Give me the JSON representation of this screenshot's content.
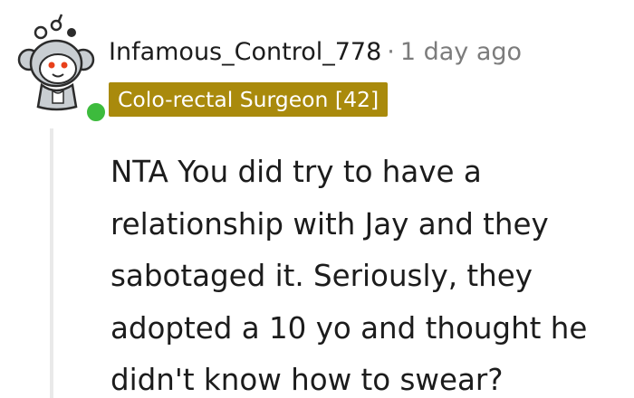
{
  "comment": {
    "username": "Infamous_Control_778",
    "separator": "·",
    "timestamp": "1 day ago",
    "flair": "Colo-rectal Surgeon [42]",
    "body_lines": [
      "NTA You did try to have a",
      "relationship with Jay and they",
      "sabotaged it. Seriously, they",
      "adopted a 10 yo and thought he",
      "didn't know how to swear?"
    ]
  },
  "colors": {
    "flair_background": "#a98a0c",
    "online_status": "#3dbb3d",
    "muted_text": "#7c7c7c"
  },
  "icons": {
    "avatar": "snoo-avatar",
    "status": "online-status-dot"
  }
}
